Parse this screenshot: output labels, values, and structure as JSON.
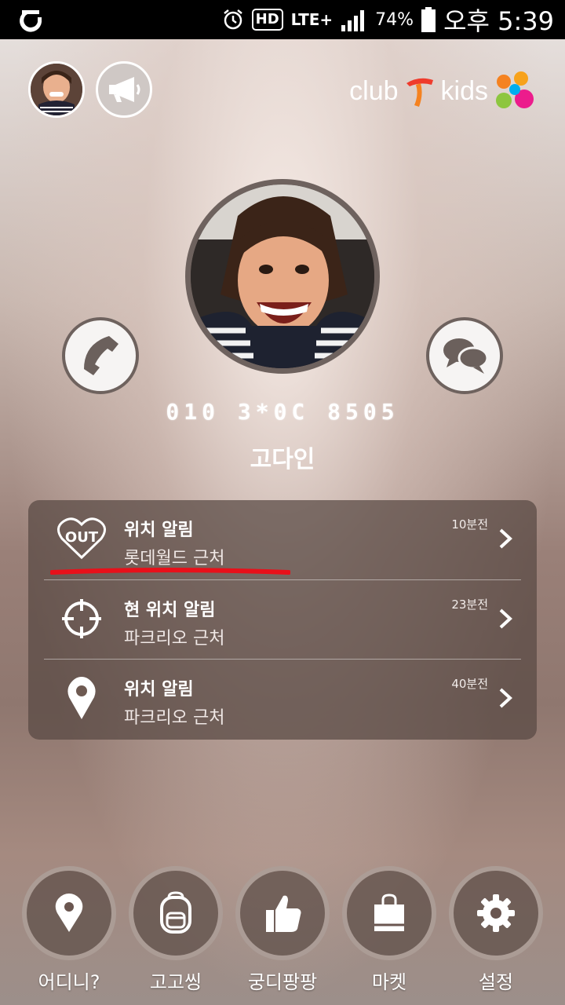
{
  "status_bar": {
    "battery": "74%",
    "time": "오후 5:39",
    "network": "LTE+",
    "hd": "HD"
  },
  "brand": {
    "club": "club",
    "kids": "kids"
  },
  "profile": {
    "phone": "010 3*0C 8505",
    "name": "고다인"
  },
  "alerts": [
    {
      "title": "위치 알림",
      "subtitle": "롯데월드 근처",
      "time": "10분전",
      "icon": "out-heart-icon"
    },
    {
      "title": "현 위치 알림",
      "subtitle": "파크리오 근처",
      "time": "23분전",
      "icon": "crosshair-icon"
    },
    {
      "title": "위치 알림",
      "subtitle": "파크리오 근처",
      "time": "40분전",
      "icon": "map-pin-icon"
    }
  ],
  "nav": [
    {
      "label": "어디니?",
      "icon": "location-pin-icon"
    },
    {
      "label": "고고씽",
      "icon": "backpack-icon"
    },
    {
      "label": "궁디팡팡",
      "icon": "thumbs-up-icon"
    },
    {
      "label": "마켓",
      "icon": "shopping-bag-icon"
    },
    {
      "label": "설정",
      "icon": "gear-icon"
    }
  ],
  "colors": {
    "underline": "#e8101a",
    "panel": "#584842"
  }
}
